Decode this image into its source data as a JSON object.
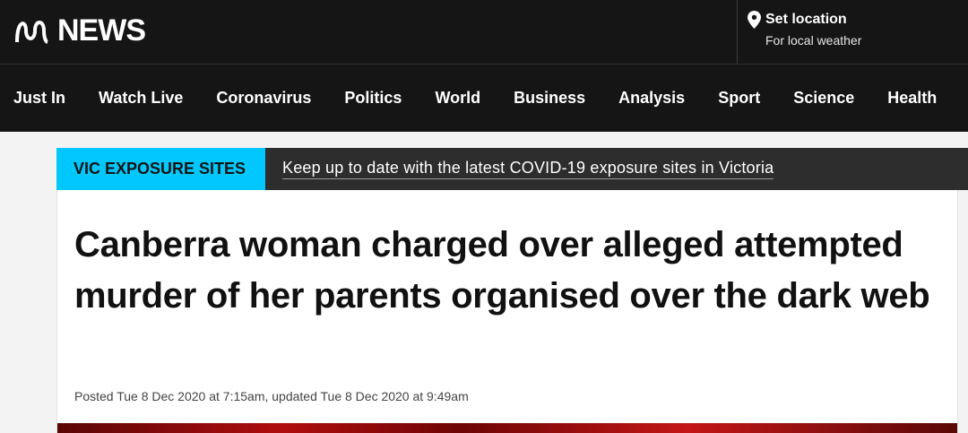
{
  "header": {
    "logo_text": "NEWS",
    "logo_icon": "abc-lissajous-logo-icon",
    "location_title": "Set location",
    "location_subtitle": "For local weather",
    "location_icon": "location-pin-icon"
  },
  "nav": {
    "items": [
      {
        "label": "Just In"
      },
      {
        "label": "Watch Live"
      },
      {
        "label": "Coronavirus"
      },
      {
        "label": "Politics"
      },
      {
        "label": "World"
      },
      {
        "label": "Business"
      },
      {
        "label": "Analysis"
      },
      {
        "label": "Sport"
      },
      {
        "label": "Science"
      },
      {
        "label": "Health"
      }
    ]
  },
  "alert": {
    "tag": "VIC EXPOSURE SITES",
    "message": "Keep up to date with the latest COVID-19 exposure sites in Victoria"
  },
  "article": {
    "headline": "Canberra woman charged over alleged attempted murder of her parents organised over the dark web",
    "dateline": "Posted Tue 8 Dec 2020 at 7:15am, updated Tue 8 Dec 2020 at 9:49am"
  },
  "colors": {
    "header_bg": "#151515",
    "alert_tag_bg": "#00c8ff",
    "alert_bg": "#2d2d2d"
  }
}
